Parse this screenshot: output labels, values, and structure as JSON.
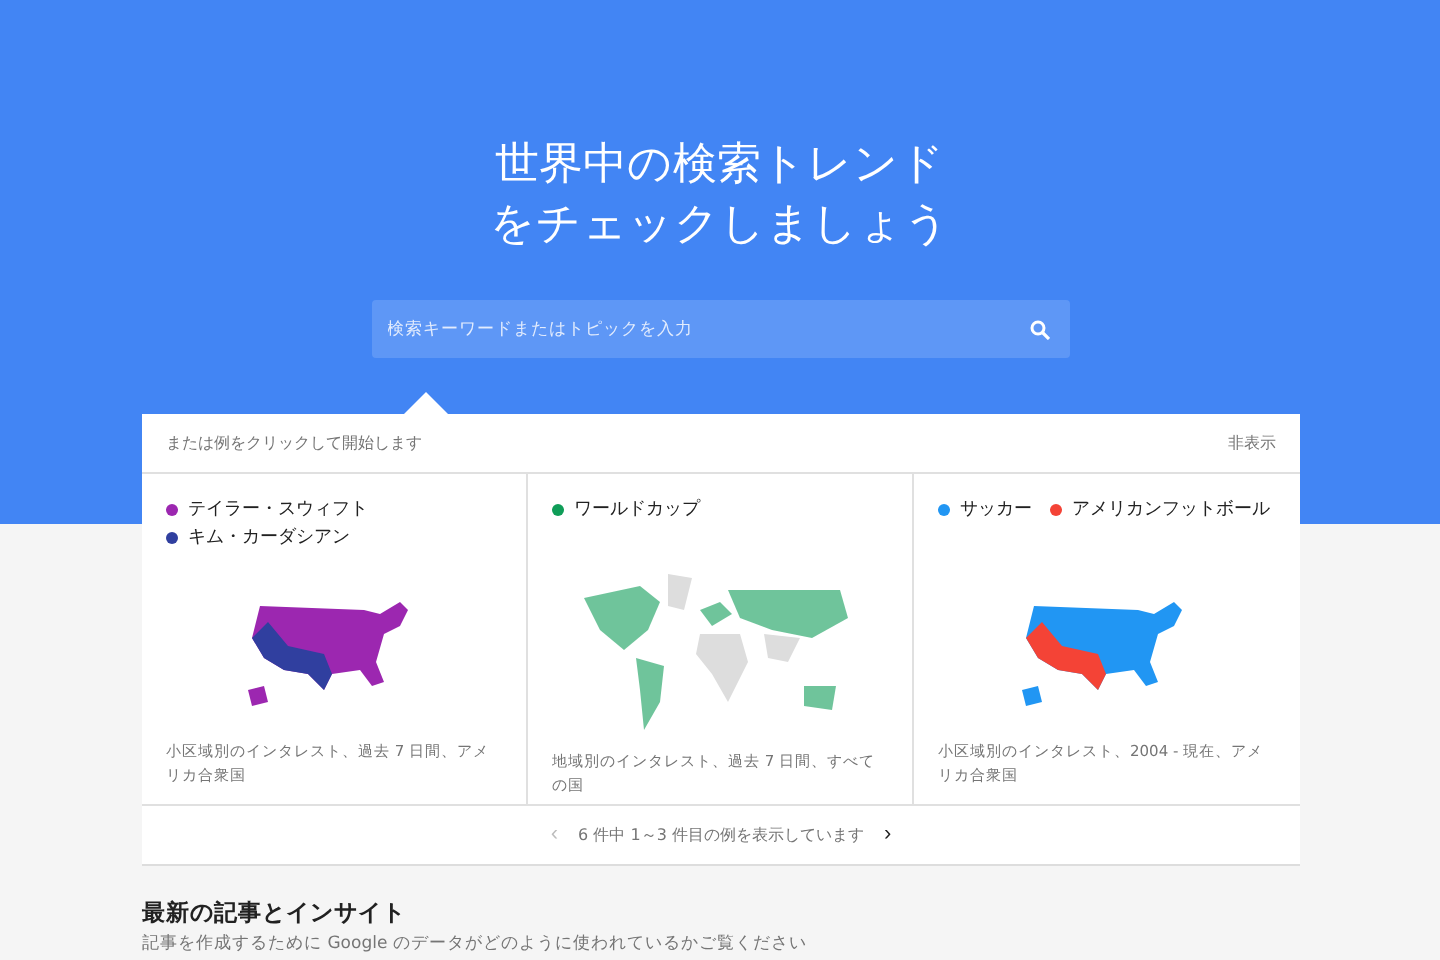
{
  "hero": {
    "title_lines": [
      "世界中の検索トレンド",
      "をチェックしましょう"
    ]
  },
  "search": {
    "placeholder": "検索キーワードまたはトピックを入力"
  },
  "examples": {
    "prompt": "または例をクリックして開始します",
    "hide_link": "非表示",
    "cards": [
      {
        "kind": "us",
        "legend": [
          {
            "label": "テイラー・スウィフト",
            "color": "#9c27b0"
          },
          {
            "label": "キム・カーダシアン",
            "color": "#303f9f"
          }
        ],
        "caption": "小区域別のインタレスト、過去 7 日間、アメリカ合衆国"
      },
      {
        "kind": "world",
        "legend": [
          {
            "label": "ワールドカップ",
            "color": "#0f9d58"
          }
        ],
        "caption": "地域別のインタレスト、過去 7 日間、すべての国"
      },
      {
        "kind": "us",
        "legend": [
          {
            "label": "サッカー",
            "color": "#2196f3"
          },
          {
            "label": "アメリカンフットボール",
            "color": "#f44336"
          }
        ],
        "caption": "小区域別のインタレスト、2004 - 現在、アメリカ合衆国"
      }
    ],
    "pager": {
      "text": "6 件中 1～3 件目の例を表示しています",
      "prev_label": "‹",
      "next_label": "›",
      "prev_disabled": true,
      "next_disabled": false
    }
  },
  "articles": {
    "heading": "最新の記事とインサイト",
    "subtitle": "記事を作成するために Google のデータがどのように使われているかご覧ください"
  }
}
